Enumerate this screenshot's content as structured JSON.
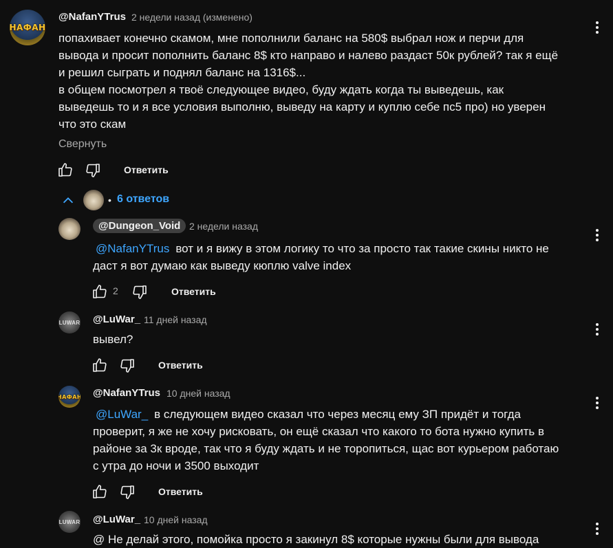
{
  "colors": {
    "background": "#0f0f0f",
    "text": "#f1f1f1",
    "secondary": "#aaaaaa",
    "accent": "#3ea6ff",
    "chip": "#3f3f3f"
  },
  "top_comment": {
    "author": "@NafanYTrus",
    "time": "2 недели назад (изменено)",
    "avatar_label": "НАФАН",
    "lines": [
      "попахивает конечно скамом, мне пополнили баланс на 580$ выбрал нож и перчи для",
      "вывода и просит пополнить баланс 8$ кто направо и налево раздаст 50к рублей? так я ещё",
      "и решил сыграть и поднял баланс на 1316$...",
      "в общем посмотрел я твоё следующее видео, буду ждать когда ты выведешь, как",
      "выведешь то и я все условия выполню, выведу на карту и куплю себе пс5 про) но уверен",
      "что это скам"
    ],
    "collapse_label": "Свернуть",
    "reply_label": "Ответить"
  },
  "replies_toggle": {
    "label": "6 ответов",
    "separator": "•"
  },
  "replies": [
    {
      "author": "@Dungeon_Void",
      "time": "2 недели назад",
      "mention": "@NafanYTrus",
      "lines": [
        "вот и я вижу в этом логику то что за просто так такие скины никто не",
        "даст я вот думаю как выведу кюплю valve index"
      ],
      "likes": "2",
      "reply_label": "Ответить"
    },
    {
      "author": "@LuWar_",
      "time": "11 дней назад",
      "avatar_label": "LUWAR",
      "lines": [
        "вывел?"
      ],
      "reply_label": "Ответить"
    },
    {
      "author": "@NafanYTrus",
      "time": "10 дней назад",
      "avatar_label": "НАФАН",
      "mention": "@LuWar_",
      "lines": [
        "в следующем видео сказал что через месяц ему ЗП придёт и тогда",
        "проверит, я же не хочу рисковать, он ещё сказал что какого то бота нужно купить в",
        "районе за 3к вроде, так что я буду ждать и не торопиться, щас вот курьером работаю",
        "с утра до ночи и 3500 выходит"
      ],
      "reply_label": "Ответить"
    },
    {
      "author": "@LuWar_",
      "time": "10 дней назад",
      "avatar_label": "LUWAR",
      "lines": [
        "@ Не делай этого, помойка просто я закинул 8$ которые нужны были для вывода"
      ]
    }
  ]
}
